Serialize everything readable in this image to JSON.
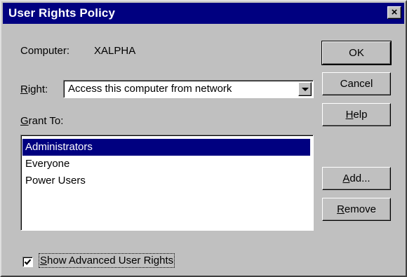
{
  "window": {
    "title": "User Rights Policy",
    "close_glyph": "×"
  },
  "computer": {
    "label": "Computer:",
    "value": "XALPHA"
  },
  "right": {
    "label_access": "R",
    "label_rest": "ight:",
    "selected_value": "Access this computer from network"
  },
  "grant_to": {
    "label_access": "G",
    "label_rest": "rant To:",
    "items": [
      "Administrators",
      "Everyone",
      "Power Users"
    ],
    "selected_index": 0
  },
  "buttons": {
    "ok": "OK",
    "cancel": "Cancel",
    "help_access": "H",
    "help_rest": "elp",
    "add_access": "A",
    "add_rest": "dd...",
    "remove_access": "R",
    "remove_rest": "emove"
  },
  "advanced": {
    "label_access": "S",
    "label_rest": "how Advanced User Rights",
    "checked": true
  },
  "colors": {
    "titlebar": "#000080",
    "face": "#c0c0c0",
    "selection": "#000080"
  }
}
